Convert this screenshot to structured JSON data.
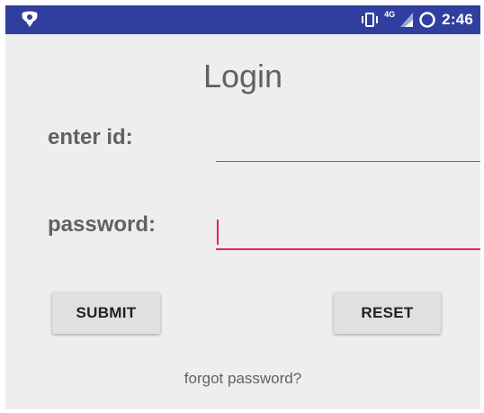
{
  "status_bar": {
    "time": "2:46",
    "network": "4G",
    "icons": [
      "notification-icon",
      "vibrate-icon",
      "signal-icon",
      "battery-ring-icon"
    ],
    "background_color": "#303f9f"
  },
  "login": {
    "title": "Login",
    "id_label": "enter id:",
    "id_value": "",
    "password_label": "password:",
    "password_value": "",
    "submit_label": "SUBMIT",
    "reset_label": "RESET",
    "forgot_link": "forgot password?"
  },
  "colors": {
    "accent": "#e91e63",
    "background": "#eeeeee",
    "text": "#616161"
  }
}
